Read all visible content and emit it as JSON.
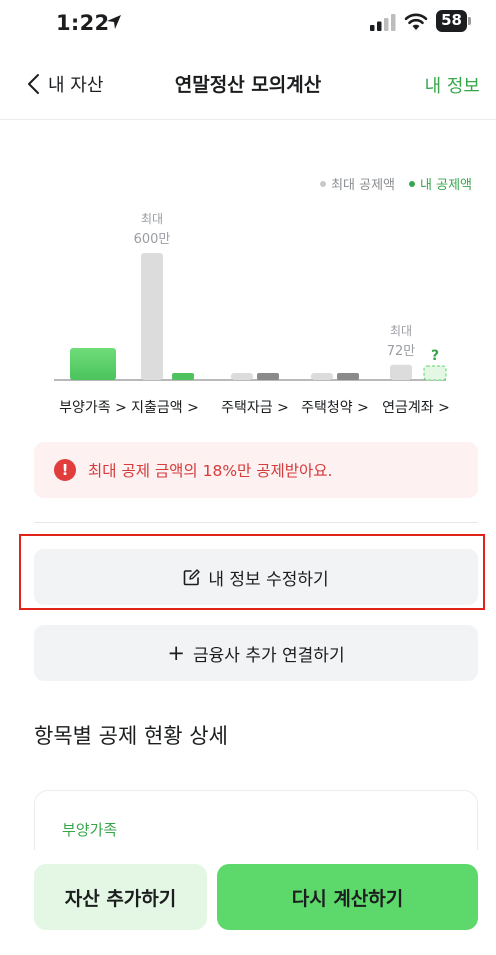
{
  "status_bar": {
    "time": "1:22",
    "battery": "58"
  },
  "nav": {
    "back_label": "내 자산",
    "title": "연말정산 모의계산",
    "action_label": "내 정보"
  },
  "legend": {
    "max_label": "최대 공제액",
    "mine_label": "내 공제액"
  },
  "colors": {
    "accent": "#3aa64c",
    "max_bar": "#dcdcdc",
    "mine_bar": "#5dd86a",
    "alert": "#e23d3d",
    "cta": "#5dd86a"
  },
  "chart_data": {
    "type": "bar",
    "categories": [
      "부양가족 >",
      "지출금액 >",
      "주택자금 >",
      "주택청약 >",
      "연금계좌 >"
    ],
    "series": [
      {
        "name": "최대 공제액",
        "values": [
          null,
          600,
          null,
          null,
          72
        ]
      },
      {
        "name": "내 공제액",
        "values": [
          null,
          null,
          null,
          null,
          null
        ]
      }
    ],
    "max_labels": [
      {
        "index": 1,
        "line1": "최대",
        "line2": "600만"
      },
      {
        "index": 4,
        "line1": "최대",
        "line2": "72만"
      }
    ],
    "unknown_marker": {
      "index": 4,
      "text": "?"
    },
    "unit": "만원"
  },
  "alert": {
    "icon": "!",
    "text": "최대 공제 금액의 18%만 공제받아요."
  },
  "buttons": {
    "edit_info": "내 정보 수정하기",
    "add_link": "금융사 추가 연결하기",
    "add_link_prefix": "+"
  },
  "section": {
    "title": "항목별 공제 현황 상세"
  },
  "card": {
    "label": "부양가족"
  },
  "bottom": {
    "asset_add": "자산 추가하기",
    "recalc": "다시 계산하기"
  }
}
